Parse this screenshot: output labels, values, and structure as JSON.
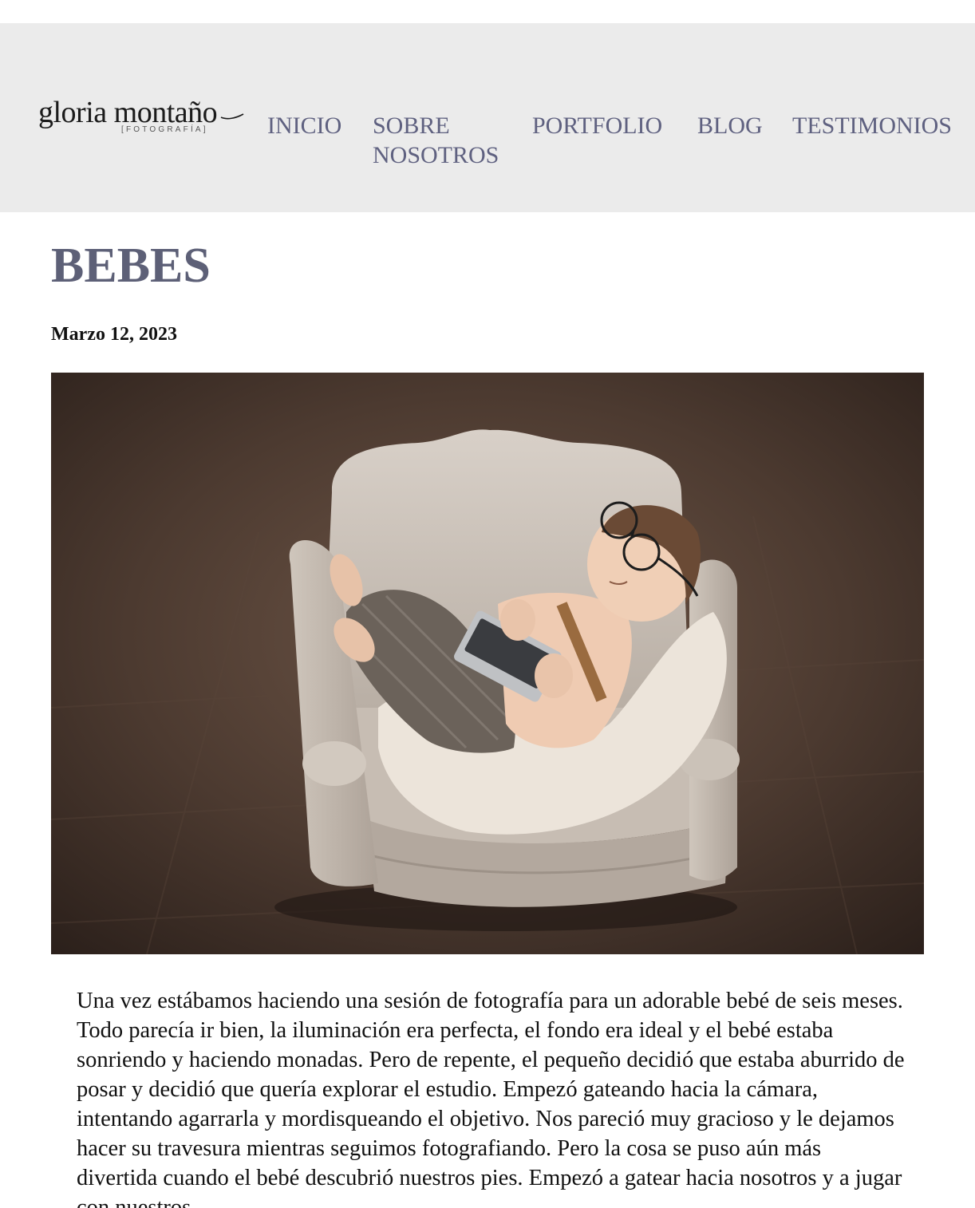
{
  "logo": {
    "name": "gloria montaño",
    "tagline": "[FOTOGRAFÍA]"
  },
  "nav": {
    "items": [
      {
        "label": "INICIO"
      },
      {
        "label": "SOBRE NOSOTROS"
      },
      {
        "label": "PORTFOLIO"
      },
      {
        "label": "BLOG"
      },
      {
        "label": "TESTIMONIOS"
      }
    ]
  },
  "post": {
    "title": "BEBES",
    "date": "Marzo 12, 2023",
    "image_icon": "photo-newborn-armchair",
    "body": "Una vez estábamos haciendo una sesión de fotografía para un adorable bebé de seis meses. Todo parecía ir bien, la iluminación era perfecta, el fondo era ideal y el bebé estaba sonriendo y haciendo monadas. Pero de repente, el pequeño decidió que estaba aburrido de posar y decidió que quería explorar el estudio. Empezó gateando hacia la cámara, intentando agarrarla y mordisqueando el objetivo. Nos pareció muy gracioso y le dejamos hacer su travesura mientras seguimos fotografiando. Pero la cosa se puso aún más divertida cuando el bebé descubrió nuestros pies. Empezó a gatear hacia nosotros y a jugar con nuestros"
  },
  "colors": {
    "header_bg": "#ebebeb",
    "nav_text": "#5f6180",
    "title": "#5d6077",
    "body_text": "#111111"
  }
}
